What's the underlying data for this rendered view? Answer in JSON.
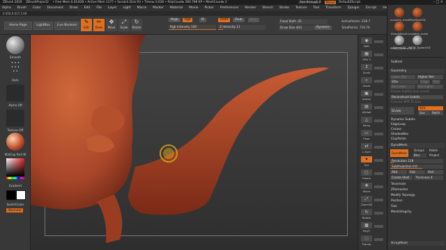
{
  "title_bar": {
    "segments": [
      "ZBrush 2019",
      "ZBrushProject2",
      "• Free Mem 0.414GB • Active Mem 1177 • Scratch Disk 93 • Timer▸ 0.636 • PolyCount▸ 260.798 KP • MeshCount▸ 2"
    ],
    "see_through": "See-through 0",
    "menus_button": "Menus",
    "script": "DefaultZScript"
  },
  "menu_bar": [
    "Alpha",
    "Brush",
    "Color",
    "Document",
    "Draw",
    "Edit",
    "File",
    "Layer",
    "Light",
    "Macro",
    "Marker",
    "Material",
    "Movie",
    "Picker",
    "Preferences",
    "Render",
    "Stencil",
    "Stroke",
    "Texture",
    "Tool",
    "Transform",
    "Zplugin",
    "Zscript",
    "Help"
  ],
  "status_line": "0.056,0.617,1.68",
  "top_bar": {
    "home_page": "Home Page",
    "lightbox": "LightBox",
    "live_boolean": "Live Boolean",
    "tools": [
      {
        "label": "Edit",
        "icon": "edit-icon",
        "active": true
      },
      {
        "label": "Draw",
        "icon": "draw-icon",
        "active": true
      },
      {
        "label": "Move",
        "icon": "move-icon",
        "active": false
      },
      {
        "label": "Scale",
        "icon": "scale-icon",
        "active": false
      },
      {
        "label": "Rotate",
        "icon": "rotate-icon",
        "active": false
      }
    ],
    "mrgb": "Mrgb",
    "rgb": "Rgb",
    "m": "M",
    "rgb_intensity_label": "Rgb Intensity",
    "rgb_intensity_value": "100",
    "rgb_intensity_fraction": 1.0,
    "zadd": "Zadd",
    "zsub": "Zsub",
    "zcut": "Zcut",
    "z_intensity_label": "Z Intensity",
    "z_intensity_value": "11",
    "z_intensity_fraction": 0.11,
    "focal_shift_label": "Focal Shift",
    "focal_shift_value": "-35",
    "draw_size_label": "Draw Size",
    "draw_size_value": "403",
    "dynamic": "Dynamic",
    "active_points": "ActivePoints: 258.7",
    "total_points": "TotalPoints: 729.76"
  },
  "left_shelf": {
    "brush_label": "Smooth",
    "stroke_label": "Dots",
    "alpha_label": "Alpha Off",
    "texture_label": "Texture Off",
    "material_label": "MatCap Red W",
    "gradient_label": "Gradient",
    "switch_color_label": "SwitchColor",
    "alternate_label": "Alternate"
  },
  "right_icons": [
    {
      "label": "BPR",
      "icon": "bpr-icon",
      "active": false
    },
    {
      "label": "SPix 3",
      "icon": "spix-icon",
      "active": false
    },
    {
      "label": "Scroll",
      "icon": "scroll-icon",
      "active": false
    },
    {
      "label": "Zoom",
      "icon": "zoom-icon",
      "active": false
    },
    {
      "label": "Actual",
      "icon": "actual-icon",
      "active": false
    },
    {
      "label": "AAHalf",
      "icon": "aahalf-icon",
      "active": false
    },
    {
      "label": "Persp",
      "icon": "persp-icon",
      "active": false
    },
    {
      "label": "Floor",
      "icon": "floor-icon",
      "active": false
    },
    {
      "label": "L.Sym",
      "icon": "lsym-icon",
      "active": false
    },
    {
      "label": "Xyz",
      "icon": "xyz-icon",
      "active": true
    },
    {
      "label": "Frame",
      "icon": "frame-icon",
      "active": false
    },
    {
      "label": "Move",
      "icon": "move-icon",
      "active": false
    },
    {
      "label": "Zoom3D",
      "icon": "zoom3d-icon",
      "active": false
    },
    {
      "label": "Rotate",
      "icon": "rotate-icon",
      "active": false
    },
    {
      "label": "PolyF",
      "icon": "polyf-icon",
      "active": false
    },
    {
      "label": "Transp",
      "icon": "transp-icon",
      "active": false
    }
  ],
  "tray": {
    "thumbs": [
      {
        "label": "sculptris_mesh",
        "style": "orange"
      },
      {
        "label": "PolyMesh3D",
        "style": "orange"
      },
      {
        "label": "SimpleBrush",
        "style": "orange"
      },
      {
        "label": "sculptris_mesh",
        "style": "orange"
      },
      {
        "label": "Sphere3D",
        "style": "grey"
      },
      {
        "label": "PM3D_Sphere3D",
        "style": "grey"
      },
      {
        "label": "PM3D_Sphere3D_1",
        "style": "blank"
      }
    ],
    "subtool": "Subtool",
    "geometry": "Geometry",
    "lower_res": "Lower Res",
    "higher_res": "Higher Res",
    "sdiv": "SDiv",
    "cage": "Cage",
    "rstr": "Rstr",
    "del_lower": "Del Lower",
    "del_higher": "Del Higher",
    "freeze_subdiv": "Freeze SubDivision Levels",
    "reconstruct_subdiv": "Reconstruct Subdiv",
    "convert_bpr": "Convert BPR To Geo",
    "divide": "Divide",
    "smt": "Smt",
    "suv": "Suv",
    "rsmt": "ReUV",
    "dynamic_subdiv": "Dynamic Subdiv",
    "edgeloop": "EdgeLoop",
    "crease": "Crease",
    "shadowbox": "ShadowBox",
    "claypolish": "ClayPolish",
    "dynamesh_header": "DynaMesh",
    "dynamesh_btn": "DynaMesh",
    "groups": "Groups",
    "polish": "Polish",
    "blur": "Blur",
    "project": "Project",
    "resolution_label": "Resolution",
    "resolution_value": "128",
    "resolution_fraction": 0.06,
    "subprojection_label": "SubProjection",
    "subprojection_value": "0.6",
    "subprojection_fraction": 0.6,
    "add": "Add",
    "sub": "Sub",
    "and": "And",
    "create_shell": "Create Shell",
    "thickness_label": "Thickness",
    "thickness_value": "4",
    "tessimate": "Tessimate",
    "zremesher": "ZRemesher",
    "modify_topology": "Modify Topology",
    "position": "Position",
    "size": "Size",
    "meshintegrity": "MeshIntegrity",
    "arraymesh": "ArrayMesh"
  },
  "colors": {
    "accent": "#e07020",
    "model": "#b5502c",
    "cursor": "#d4a020"
  }
}
